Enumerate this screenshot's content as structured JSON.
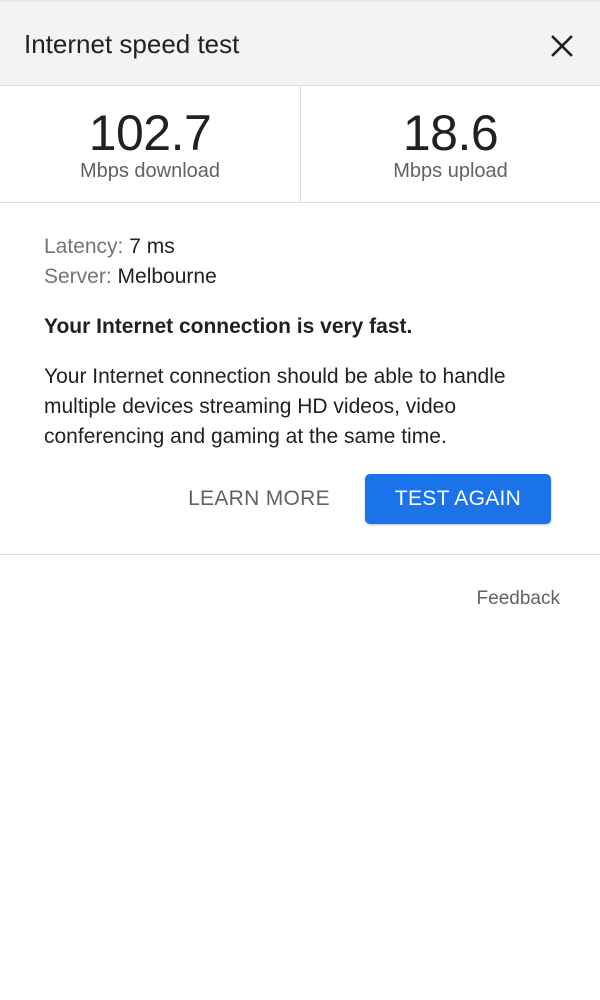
{
  "header": {
    "title": "Internet speed test",
    "close_icon": "close-icon"
  },
  "stats": {
    "download": {
      "value": "102.7",
      "unit": "Mbps download"
    },
    "upload": {
      "value": "18.6",
      "unit": "Mbps upload"
    }
  },
  "details": {
    "latency_label": "Latency:",
    "latency_value": "7 ms",
    "server_label": "Server:",
    "server_value": "Melbourne"
  },
  "verdict": "Your Internet connection is very fast.",
  "description": "Your Internet connection should be able to handle multiple devices streaming HD videos, video conferencing and gaming at the same time.",
  "actions": {
    "learn_more": "LEARN MORE",
    "test_again": "TEST AGAIN"
  },
  "feedback": "Feedback",
  "colors": {
    "accent": "#1a73e8",
    "header_bg": "#f1f3f4",
    "divider": "#dadce0",
    "secondary_text": "#5f6368"
  }
}
